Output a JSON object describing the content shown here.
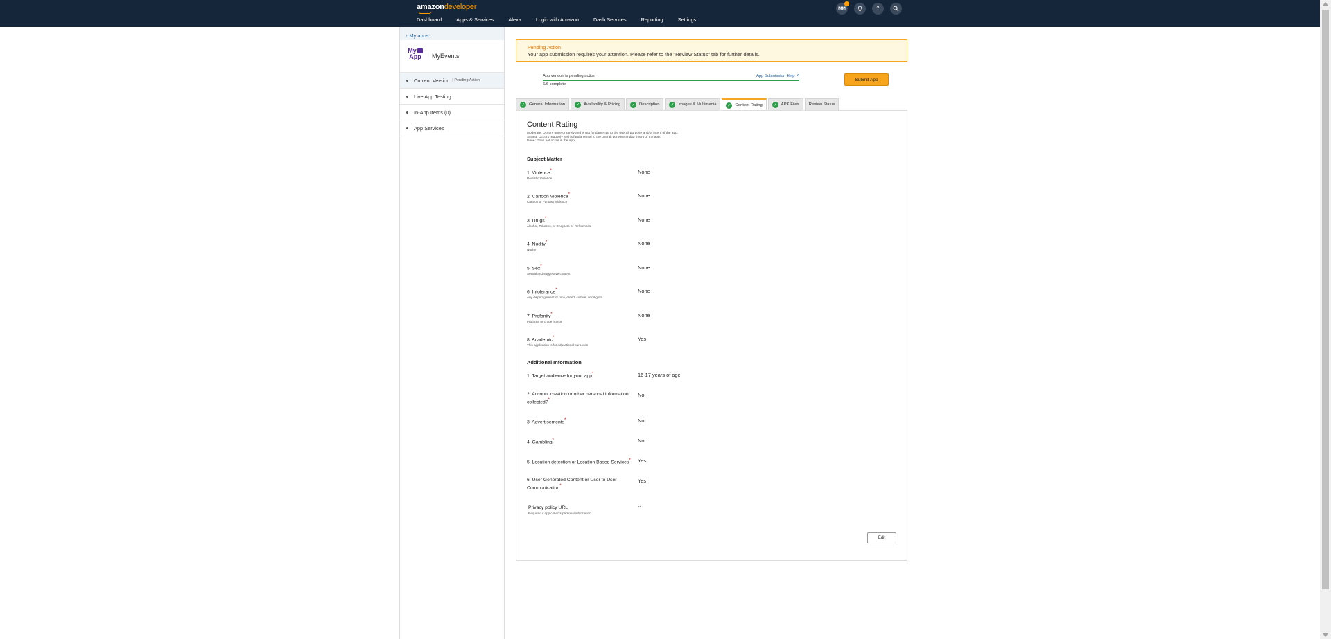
{
  "header": {
    "logo_brand": "amazon",
    "logo_suffix": "developer",
    "nav": [
      "Dashboard",
      "Apps & Services",
      "Alexa",
      "Login with Amazon",
      "Dash Services",
      "Reporting",
      "Settings"
    ],
    "user_initials": "MM",
    "icons": [
      "bell-icon",
      "help-icon",
      "search-icon"
    ]
  },
  "sidebar": {
    "back_link": "My apps",
    "app_logo_text_1": "My",
    "app_logo_text_2": "App",
    "app_name": "MyEvents",
    "items": [
      {
        "label": "Current Version",
        "sub": "Pending Action"
      },
      {
        "label": "Live App Testing"
      },
      {
        "label": "In-App Items (0)"
      },
      {
        "label": "App Services"
      }
    ]
  },
  "alert": {
    "title": "Pending Action",
    "message": "Your app submission requires your attention. Please refer to the \"Review Status\" tab for further details."
  },
  "progress": {
    "status": "App version is pending action",
    "help_link": "App Submission Help",
    "complete": "6/6 complete",
    "fraction": 1.0
  },
  "submit_button": "Submit App",
  "tabs": [
    {
      "label": "General Information",
      "checked": true
    },
    {
      "label": "Availability & Pricing",
      "checked": true
    },
    {
      "label": "Description",
      "checked": true
    },
    {
      "label": "Images & Multimedia",
      "checked": true
    },
    {
      "label": "Content Rating",
      "checked": true,
      "active": true
    },
    {
      "label": "APK Files",
      "checked": true
    },
    {
      "label": "Review Status",
      "checked": false
    }
  ],
  "content": {
    "title": "Content Rating",
    "legend": [
      "Moderate: Occurs once or rarely and is not fundamental to the overall purpose and/or intent of the app.",
      "Strong: Occurs regularly and is fundamental to the overall purpose and/or intent of the app.",
      "None: Does not occur in the app."
    ],
    "subject_matter_heading": "Subject Matter",
    "subject_matter": [
      {
        "label": "1. Violence",
        "desc": "Realistic Violence",
        "answer": "None"
      },
      {
        "label": "2. Cartoon Violence",
        "desc": "Cartoon or Fantasy Violence",
        "answer": "None"
      },
      {
        "label": "3. Drugs",
        "desc": "Alcohol, Tobacco, or Drug Use or References",
        "answer": "None"
      },
      {
        "label": "4. Nudity",
        "desc": "Nudity",
        "answer": "None"
      },
      {
        "label": "5. Sex",
        "desc": "Sexual and suggestive content",
        "answer": "None"
      },
      {
        "label": "6. Intolerance",
        "desc": "Any disparagement of race, creed, culture, or religion",
        "answer": "None"
      },
      {
        "label": "7. Profanity",
        "desc": "Profanity or crude humor",
        "answer": "None"
      },
      {
        "label": "8. Academic",
        "desc": "This application is for educational purposes",
        "answer": "Yes"
      }
    ],
    "additional_heading": "Additional Information",
    "additional": [
      {
        "label": "1. Target audience for your app",
        "answer": "16-17 years of age"
      },
      {
        "label": "2. Account creation or other personal information collected?",
        "answer": "No"
      },
      {
        "label": "3. Advertisements",
        "answer": "No"
      },
      {
        "label": "4. Gambling",
        "answer": "No"
      },
      {
        "label": "5. Location detection or Location Based Services",
        "answer": "Yes"
      },
      {
        "label": "6. User Generated Content or User to User Communication",
        "answer": "Yes"
      }
    ],
    "privacy": {
      "label": "Privacy policy URL",
      "desc": "Required if app collects personal information",
      "answer": "--"
    },
    "edit_button": "Edit"
  }
}
